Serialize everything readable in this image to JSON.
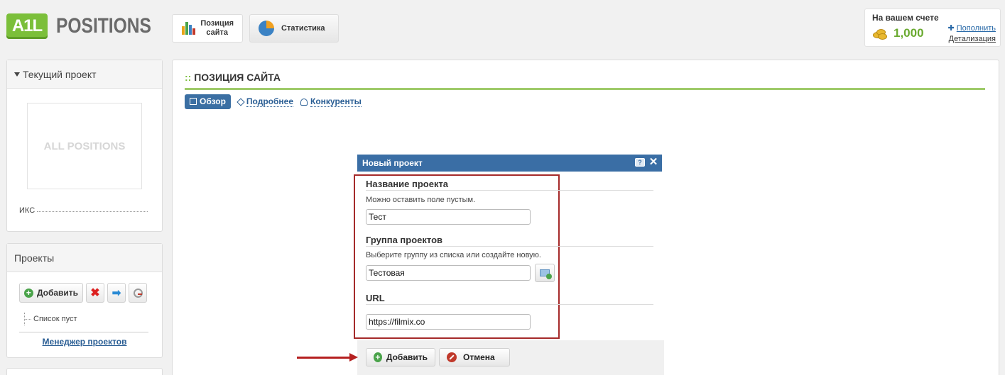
{
  "brand": {
    "badge": "A1L",
    "name": "POSITIONS",
    "placeholder_logo": "ALL POSITIONS"
  },
  "nav": {
    "position": {
      "line1": "Позиция",
      "line2": "сайта"
    },
    "stats": {
      "label": "Статистика"
    }
  },
  "balance": {
    "title": "На вашем счете",
    "amount": "1,000",
    "topup": "Пополнить",
    "details": "Детализация"
  },
  "sidebar": {
    "current_project": {
      "title": "Текущий проект",
      "iks_label": "ИКС"
    },
    "projects": {
      "title": "Проекты",
      "add_label": "Добавить",
      "empty": "Список пуст",
      "manager_link": "Менеджер проектов"
    }
  },
  "main": {
    "title_prefix": "::",
    "title": "ПОЗИЦИЯ САЙТА",
    "tabs": [
      "Обзор",
      "Подробнее",
      "Конкуренты"
    ]
  },
  "dialog": {
    "title": "Новый проект",
    "help": "?",
    "close": "✕",
    "name_title": "Название проекта",
    "name_hint": "Можно оставить поле пустым.",
    "name_value": "Тест",
    "group_title": "Группа проектов",
    "group_hint": "Выберите группу из списка или создайте новую.",
    "group_value": "Тестовая",
    "url_title": "URL",
    "url_value": "https://filmix.co",
    "add_label": "Добавить",
    "cancel_label": "Отмена"
  },
  "colors": {
    "brand_green": "#7bbf3a",
    "dialog_blue": "#3a6ea5",
    "link_blue": "#2a5e94",
    "annotation_red": "#b52020"
  }
}
